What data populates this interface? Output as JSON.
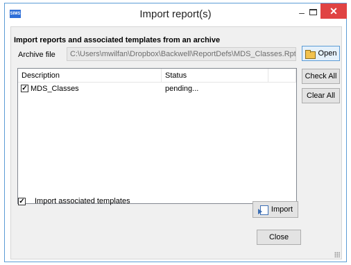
{
  "window": {
    "title": "Import report(s)",
    "app_icon_text": "SIMS",
    "min_glyph": "–",
    "close_glyph": "✕"
  },
  "heading": "Import reports and associated templates from an archive",
  "archive": {
    "label": "Archive file",
    "value": "C:\\Users\\mwilfan\\Dropbox\\Backwell\\ReportDefs\\MDS_Classes.RptDef"
  },
  "buttons": {
    "open": "Open",
    "check_all": "Check All",
    "clear_all": "Clear All",
    "import": "Import",
    "close": "Close"
  },
  "list": {
    "columns": [
      "Description",
      "Status",
      ""
    ],
    "rows": [
      {
        "checked": true,
        "check_glyph": "✓",
        "description": "MDS_Classes",
        "status": "pending..."
      }
    ]
  },
  "options": {
    "import_templates_label": "Import associated templates",
    "import_templates_checked": true,
    "check_glyph": "✓"
  },
  "colors": {
    "accent": "#5b9bd5",
    "close_button": "#e04343",
    "dialog_bg": "#f0f0f0"
  },
  "icons": {
    "open": "folder-open-icon",
    "import": "import-icon"
  }
}
